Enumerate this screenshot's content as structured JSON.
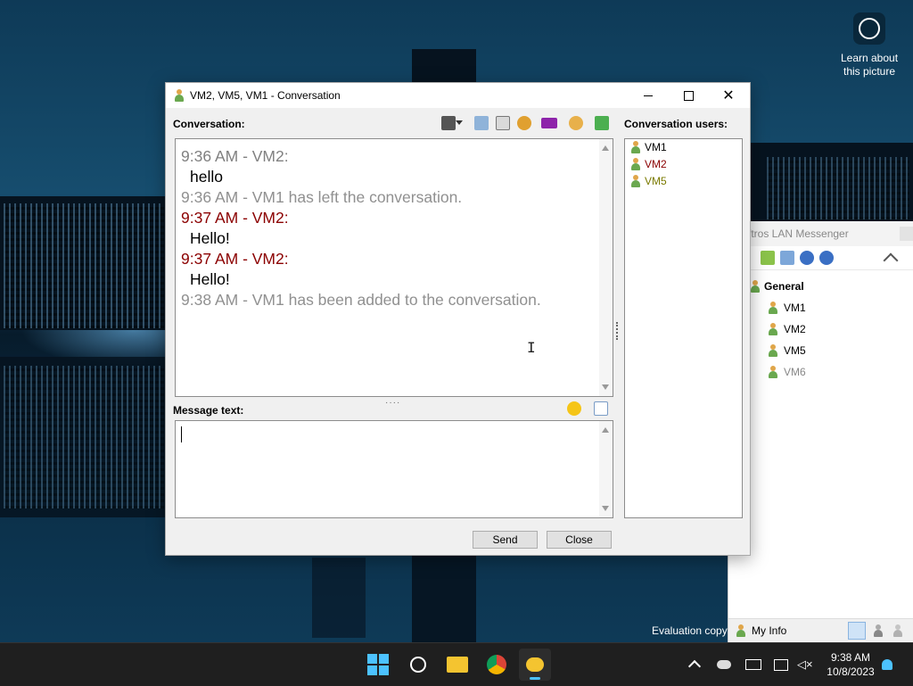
{
  "desktop": {
    "learn_label": "Learn about this picture",
    "evaluation_label": "Evaluation copy"
  },
  "main_window": {
    "title": "ftros LAN Messenger",
    "group": "General",
    "members": [
      {
        "name": "VM1",
        "active": true
      },
      {
        "name": "VM2",
        "active": true
      },
      {
        "name": "VM5",
        "active": true
      },
      {
        "name": "VM6",
        "active": false
      }
    ],
    "status_label": "My Info"
  },
  "conversation_window": {
    "title": "VM2, VM5, VM1 - Conversation",
    "conversation_label": "Conversation:",
    "users_label": "Conversation users:",
    "message_text_label": "Message text:",
    "messages": [
      {
        "header": "9:36 AM - VM2:",
        "header_color": "#808080",
        "text": "hello"
      },
      {
        "system": "9:36 AM - VM1 has left the conversation."
      },
      {
        "header": "9:37 AM - VM2:",
        "header_color": "#8b0000",
        "text": "Hello!"
      },
      {
        "header": "9:37 AM - VM2:",
        "header_color": "#8b0000",
        "text": "Hello!"
      },
      {
        "system": "9:38 AM - VM1 has been added to the conversation."
      }
    ],
    "users": [
      {
        "name": "VM1",
        "color": "#000000"
      },
      {
        "name": "VM2",
        "color": "#8b0000"
      },
      {
        "name": "VM5",
        "color": "#7a7a00"
      }
    ],
    "message_input_value": "",
    "send_label": "Send",
    "close_label": "Close"
  },
  "taskbar": {
    "time": "9:38 AM",
    "date": "10/8/2023",
    "apps": [
      "start-icon",
      "search-icon",
      "file-explorer-icon",
      "chrome-icon",
      "lan-messenger-icon"
    ]
  }
}
